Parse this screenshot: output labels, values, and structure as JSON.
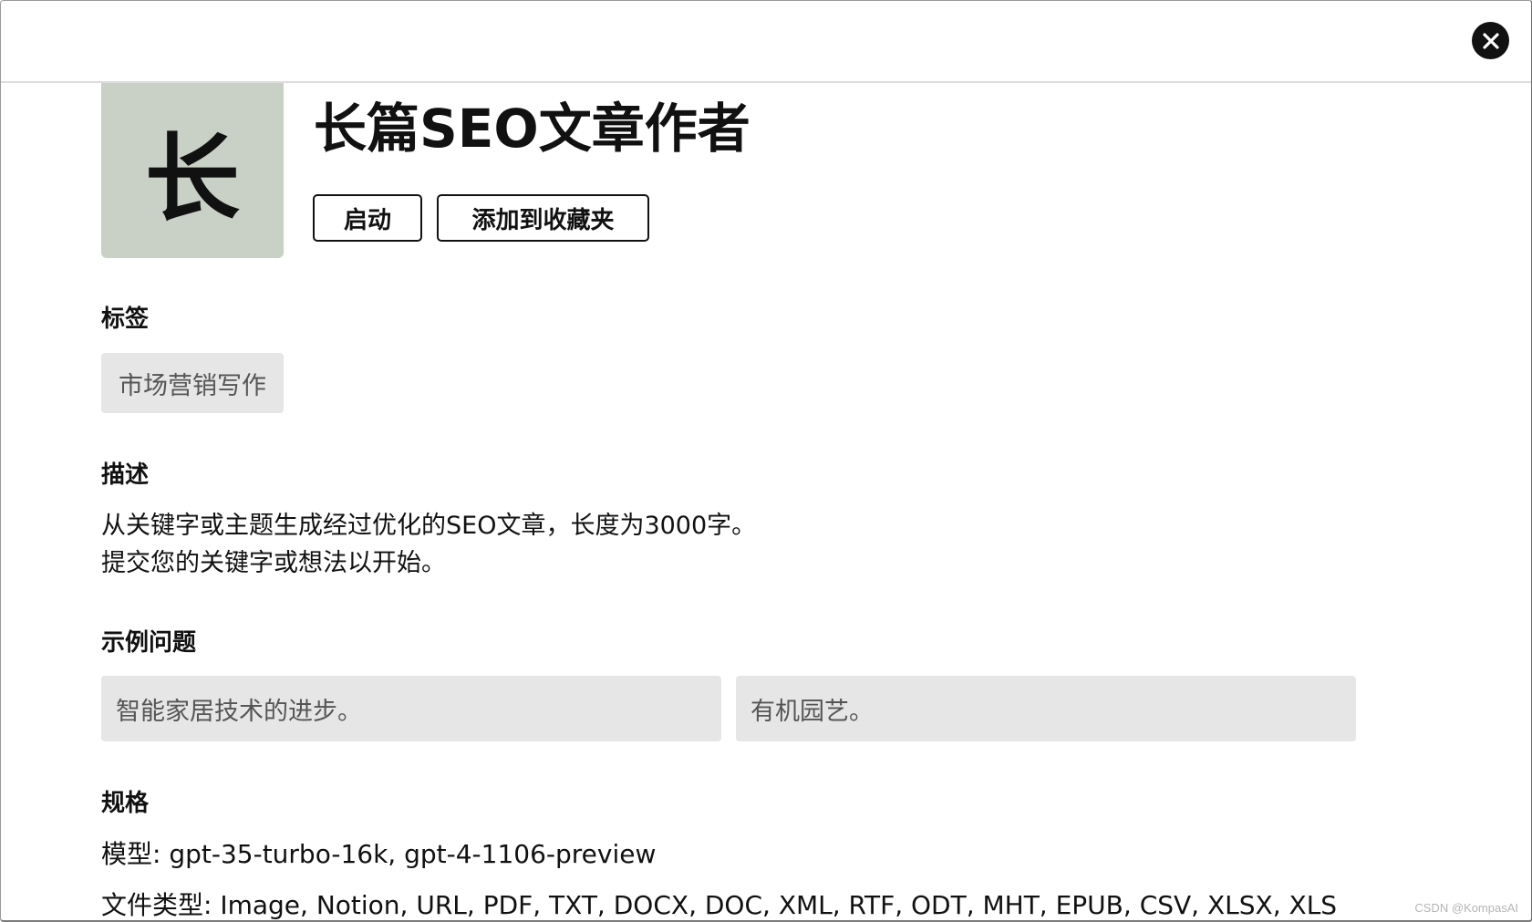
{
  "header": {
    "close_icon": "close-icon"
  },
  "profile": {
    "avatar_char": "长",
    "title": "长篇SEO文章作者",
    "launch_label": "启动",
    "favorite_label": "添加到收藏夹"
  },
  "tags": {
    "heading": "标签",
    "items": [
      "市场营销写作"
    ]
  },
  "description": {
    "heading": "描述",
    "lines": [
      "从关键字或主题生成经过优化的SEO文章，长度为3000字。",
      "提交您的关键字或想法以开始。"
    ]
  },
  "examples": {
    "heading": "示例问题",
    "items": [
      "智能家居技术的进步。",
      "有机园艺。"
    ]
  },
  "specs": {
    "heading": "规格",
    "model_line": "模型: gpt-35-turbo-16k, gpt-4-1106-preview",
    "file_types_line": "文件类型: Image, Notion, URL, PDF, TXT, DOCX, DOC, XML, RTF, ODT, MHT, EPUB, CSV, XLSX, XLS"
  },
  "watermark": "CSDN @KompasAI"
}
